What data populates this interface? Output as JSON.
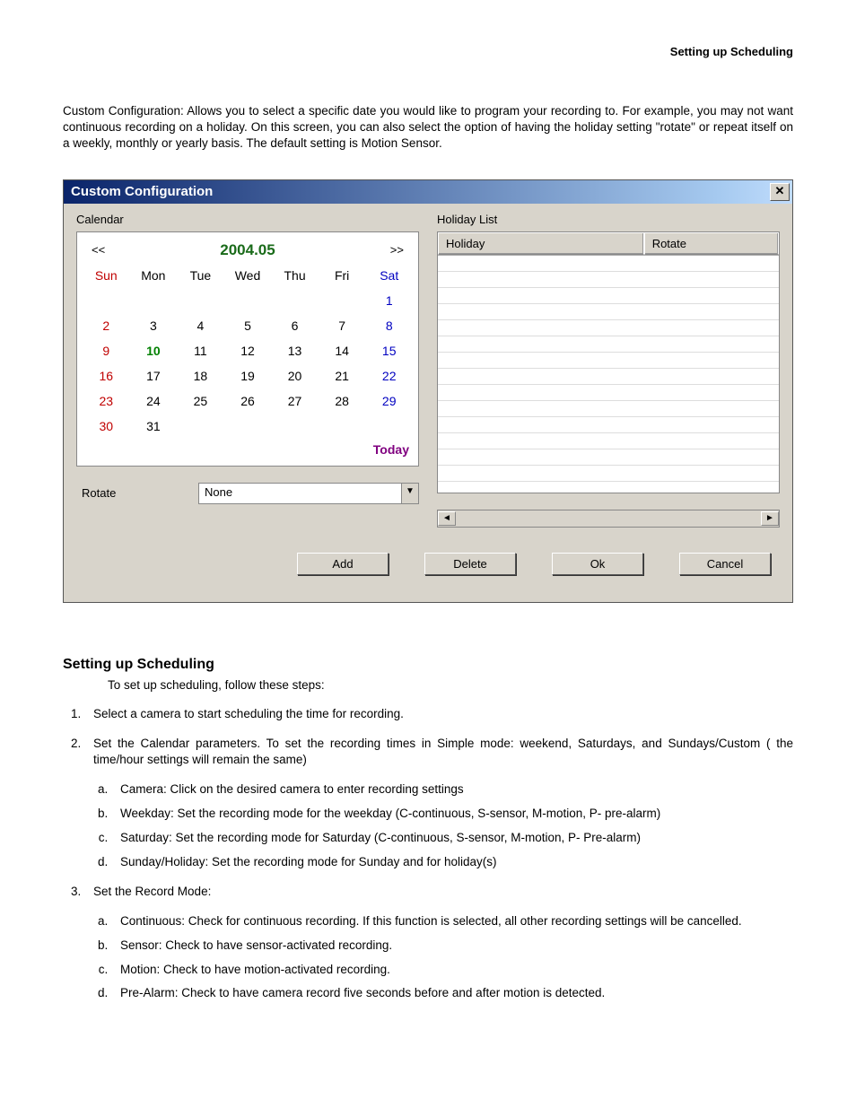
{
  "header": "Setting up Scheduling",
  "intro": "Custom Configuration: Allows you to select a specific date you would like to program your recording to. For example, you may not want continuous recording on a holiday. On this screen, you can also select the option of having the holiday setting \"rotate\" or repeat itself on a weekly, monthly or yearly basis. The default setting is Motion Sensor.",
  "dialog": {
    "title": "Custom Configuration",
    "close_glyph": "✕",
    "calendar_label": "Calendar",
    "holiday_label": "Holiday List",
    "nav_prev": "<<",
    "nav_next": ">>",
    "month": "2004.05",
    "dow": [
      "Sun",
      "Mon",
      "Tue",
      "Wed",
      "Thu",
      "Fri",
      "Sat"
    ],
    "weeks": [
      [
        "",
        "",
        "",
        "",
        "",
        "",
        "1"
      ],
      [
        "2",
        "3",
        "4",
        "5",
        "6",
        "7",
        "8"
      ],
      [
        "9",
        "10",
        "11",
        "12",
        "13",
        "14",
        "15"
      ],
      [
        "16",
        "17",
        "18",
        "19",
        "20",
        "21",
        "22"
      ],
      [
        "23",
        "24",
        "25",
        "26",
        "27",
        "28",
        "29"
      ],
      [
        "30",
        "31",
        "",
        "",
        "",
        "",
        ""
      ]
    ],
    "today_day": "10",
    "today_link": "Today",
    "rotate_label": "Rotate",
    "rotate_value": "None",
    "list_cols": {
      "holiday": "Holiday",
      "rotate": "Rotate"
    },
    "buttons": {
      "add": "Add",
      "delete": "Delete",
      "ok": "Ok",
      "cancel": "Cancel"
    }
  },
  "section": {
    "title": "Setting up Scheduling",
    "lead": "To set up scheduling, follow these steps:",
    "steps": [
      "Select a camera to start scheduling the time for recording.",
      "Set the Calendar parameters. To set the recording times in Simple mode: weekend, Saturdays, and Sundays/Custom ( the time/hour settings will remain the same)",
      "Set the Record Mode:"
    ],
    "sub2": [
      "Camera: Click on the desired camera to enter recording settings",
      "Weekday: Set the recording mode for the weekday (C-continuous, S-sensor, M-motion, P- pre-alarm)",
      "Saturday: Set the recording mode for Saturday (C-continuous, S-sensor, M-motion, P- Pre-alarm)",
      "Sunday/Holiday: Set the recording mode for Sunday and for holiday(s)"
    ],
    "sub3": [
      "Continuous: Check for continuous recording. If this function is selected, all other recording settings will be cancelled.",
      "Sensor: Check to have sensor-activated recording.",
      "Motion: Check to have motion-activated recording.",
      "Pre-Alarm: Check to have camera record five seconds before and after motion is detected."
    ]
  }
}
